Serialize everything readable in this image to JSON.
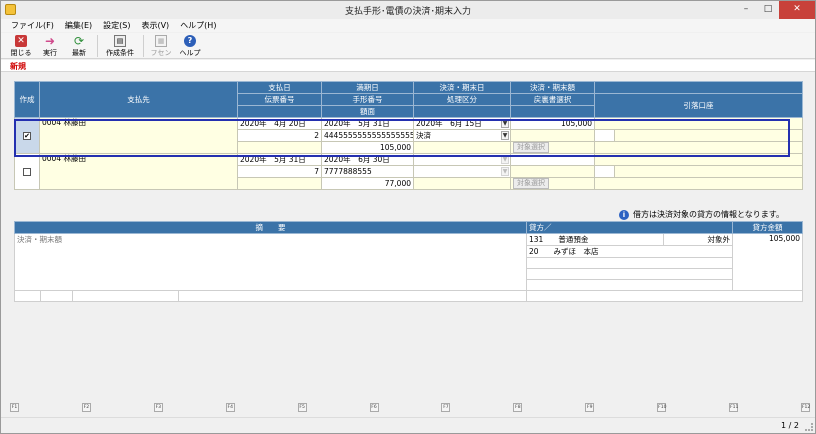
{
  "window": {
    "title": "支払手形･電債の決済･期末入力",
    "minimize": "–",
    "maximize": "□",
    "close": "✕"
  },
  "menu": [
    {
      "label": "ファイル(F)"
    },
    {
      "label": "編集(E)"
    },
    {
      "label": "設定(S)"
    },
    {
      "label": "表示(V)"
    },
    {
      "label": "ヘルプ(H)"
    }
  ],
  "toolbar": [
    {
      "label": "閉じる",
      "icon": "close-doc-icon",
      "color": "#c83838"
    },
    {
      "label": "実行",
      "icon": "arrow-right-icon",
      "color": "#d04a8c"
    },
    {
      "label": "最新",
      "icon": "refresh-icon",
      "color": "#2f8f3a"
    },
    {
      "label": "作成条件",
      "icon": "condition-icon",
      "color": "#555555"
    },
    {
      "label": "フセン",
      "icon": "sticky-note-icon",
      "color": "#9a9a9a"
    },
    {
      "label": "ヘルプ",
      "icon": "help-icon",
      "color": "#2d5fb8"
    }
  ],
  "mode": "新規",
  "grid": {
    "headers": {
      "create": "作成",
      "payee": "支払先",
      "pay_date": "支払日",
      "slip_no": "伝票番号",
      "due_date": "満期日",
      "bill_no": "手形番号",
      "face": "額面",
      "settle_date": "決済・期末日",
      "process": "処理区分",
      "settle_amount": "決済・期末額",
      "return_select": "戻裏書選択",
      "account": "引落口座"
    },
    "rows": [
      {
        "checked": "✔",
        "payee": "0004 林藤田",
        "pay_date": "2020年　4月 20日",
        "slip_no": "2",
        "due_date": "2020年　5月 31日",
        "bill_no": "44455555555555555555",
        "face": "105,000",
        "settle_date": "2020年　6月 15日",
        "process": "決済",
        "settle_amount": "105,000",
        "target_button": "対象選択"
      },
      {
        "checked": "",
        "payee": "0004 林藤田",
        "pay_date": "2020年　5月 31日",
        "slip_no": "7",
        "due_date": "2020年　6月 30日",
        "bill_no": "7777888555",
        "face": "77,000",
        "settle_date": "",
        "process": "",
        "settle_amount": "",
        "target_button": "対象選択"
      }
    ]
  },
  "info": {
    "text": "借方は決済対象の貸方の情報となります。"
  },
  "detail": {
    "headers": {
      "summary": "摘　　要",
      "credit": "貸方／",
      "credit_amount": "貸方金額"
    },
    "summary_text": "決済・期末額",
    "credit_rows": [
      {
        "code": "131",
        "name": "普通預金",
        "note": "対象外"
      },
      {
        "code": "20",
        "name": "みずほ　本店",
        "note": ""
      }
    ],
    "credit_amount": "105,000"
  },
  "fkeys": [
    "F1",
    "F2",
    "F3",
    "F4",
    "F5",
    "F6",
    "F7",
    "F8",
    "F9",
    "F10",
    "F11",
    "F12"
  ],
  "status": {
    "page": "1 / 2"
  }
}
